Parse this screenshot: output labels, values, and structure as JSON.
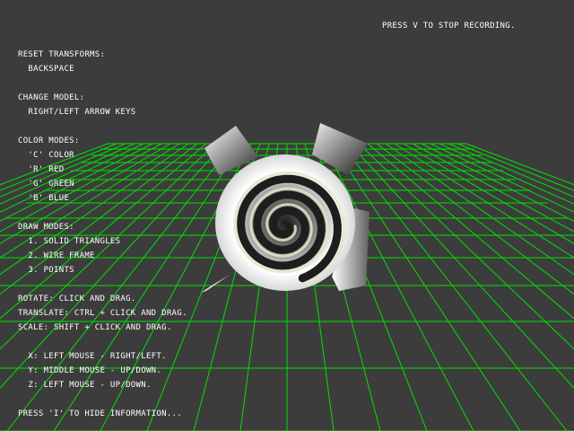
{
  "colors": {
    "background": "#3c3c3c",
    "grid": "#00e000",
    "text": "#ffffff"
  },
  "recording": {
    "status": "PRESS V TO STOP RECORDING."
  },
  "info_panel": {
    "lines": [
      "RESET TRANSFORMS:",
      "  BACKSPACE",
      "",
      "CHANGE MODEL:",
      "  RIGHT/LEFT ARROW KEYS",
      "",
      "COLOR MODES:",
      "  'C' COLOR",
      "  'R' RED",
      "  'G' GREEN",
      "  'B' BLUE",
      "",
      "DRAW MODES:",
      "  1. SOLID TRIANGLES",
      "  2. WIRE FRAME",
      "  3. POINTS",
      "",
      "ROTATE: CLICK AND DRAG.",
      "TRANSLATE: CTRL + CLICK AND DRAG.",
      "SCALE: SHIFT + CLICK AND DRAG.",
      "",
      "  X: LEFT MOUSE - RIGHT/LEFT.",
      "  Y: MIDDLE MOUSE - UP/DOWN.",
      "  Z: LEFT MOUSE - UP/DOWN.",
      "",
      "PRESS 'I' TO HIDE INFORMATION..."
    ]
  },
  "scene": {
    "model": "spiral-shell",
    "floor": "wireframe-grid"
  }
}
